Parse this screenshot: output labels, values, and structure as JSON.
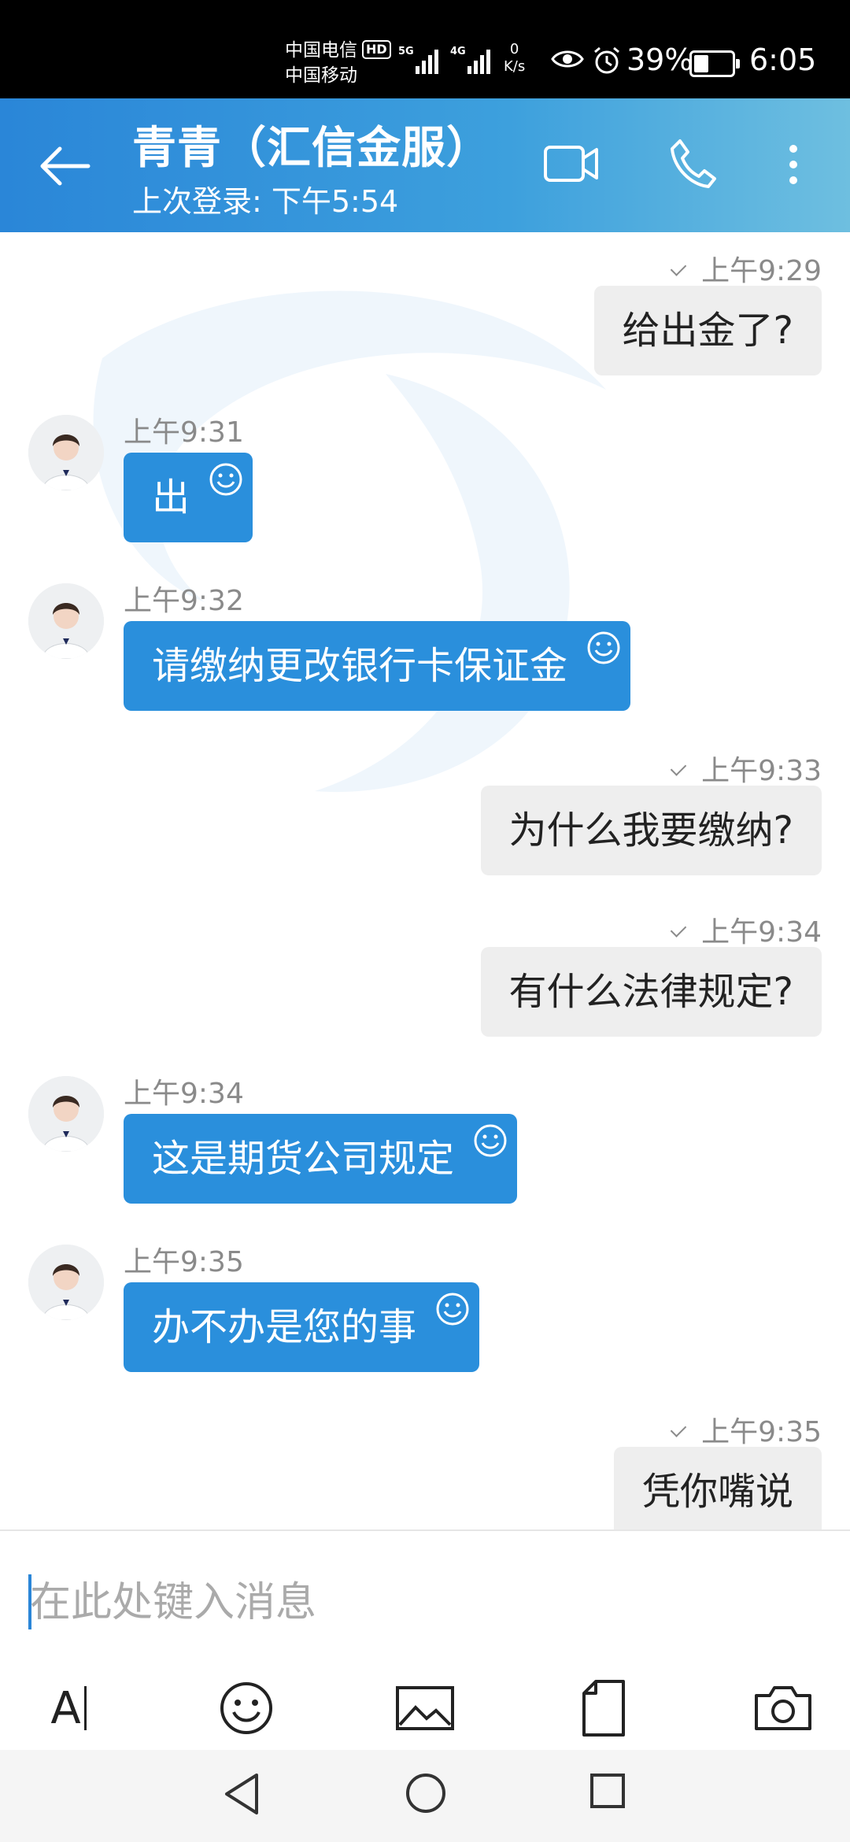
{
  "status_bar": {
    "carrier_1": "中国电信",
    "carrier_2": "中国移动",
    "hd": "HD",
    "net_1": "5G",
    "net_2": "4G",
    "speed_value": "0",
    "speed_unit": "K/s",
    "battery": "39%",
    "time": "6:05"
  },
  "header": {
    "name": "青青（汇信金服）",
    "last_login": "上次登录: 下午5:54"
  },
  "messages": [
    {
      "side": "out",
      "time": "上午9:29",
      "text": "给出金了?"
    },
    {
      "side": "in",
      "time": "上午9:31",
      "text": "出"
    },
    {
      "side": "in",
      "time": "上午9:32",
      "text": "请缴纳更改银行卡保证金"
    },
    {
      "side": "out",
      "time": "上午9:33",
      "text": "为什么我要缴纳?"
    },
    {
      "side": "out",
      "time": "上午9:34",
      "text": "有什么法律规定?"
    },
    {
      "side": "in",
      "time": "上午9:34",
      "text": "这是期货公司规定"
    },
    {
      "side": "in",
      "time": "上午9:35",
      "text": "办不办是您的事"
    },
    {
      "side": "out",
      "time": "上午9:35",
      "text": "凭你嘴说"
    }
  ],
  "input": {
    "placeholder": "在此处键入消息",
    "format_label": "A"
  },
  "colors": {
    "header": "#2a86d8",
    "incoming_bubble": "#2a8fdc",
    "outgoing_bubble": "#eeeeee"
  }
}
